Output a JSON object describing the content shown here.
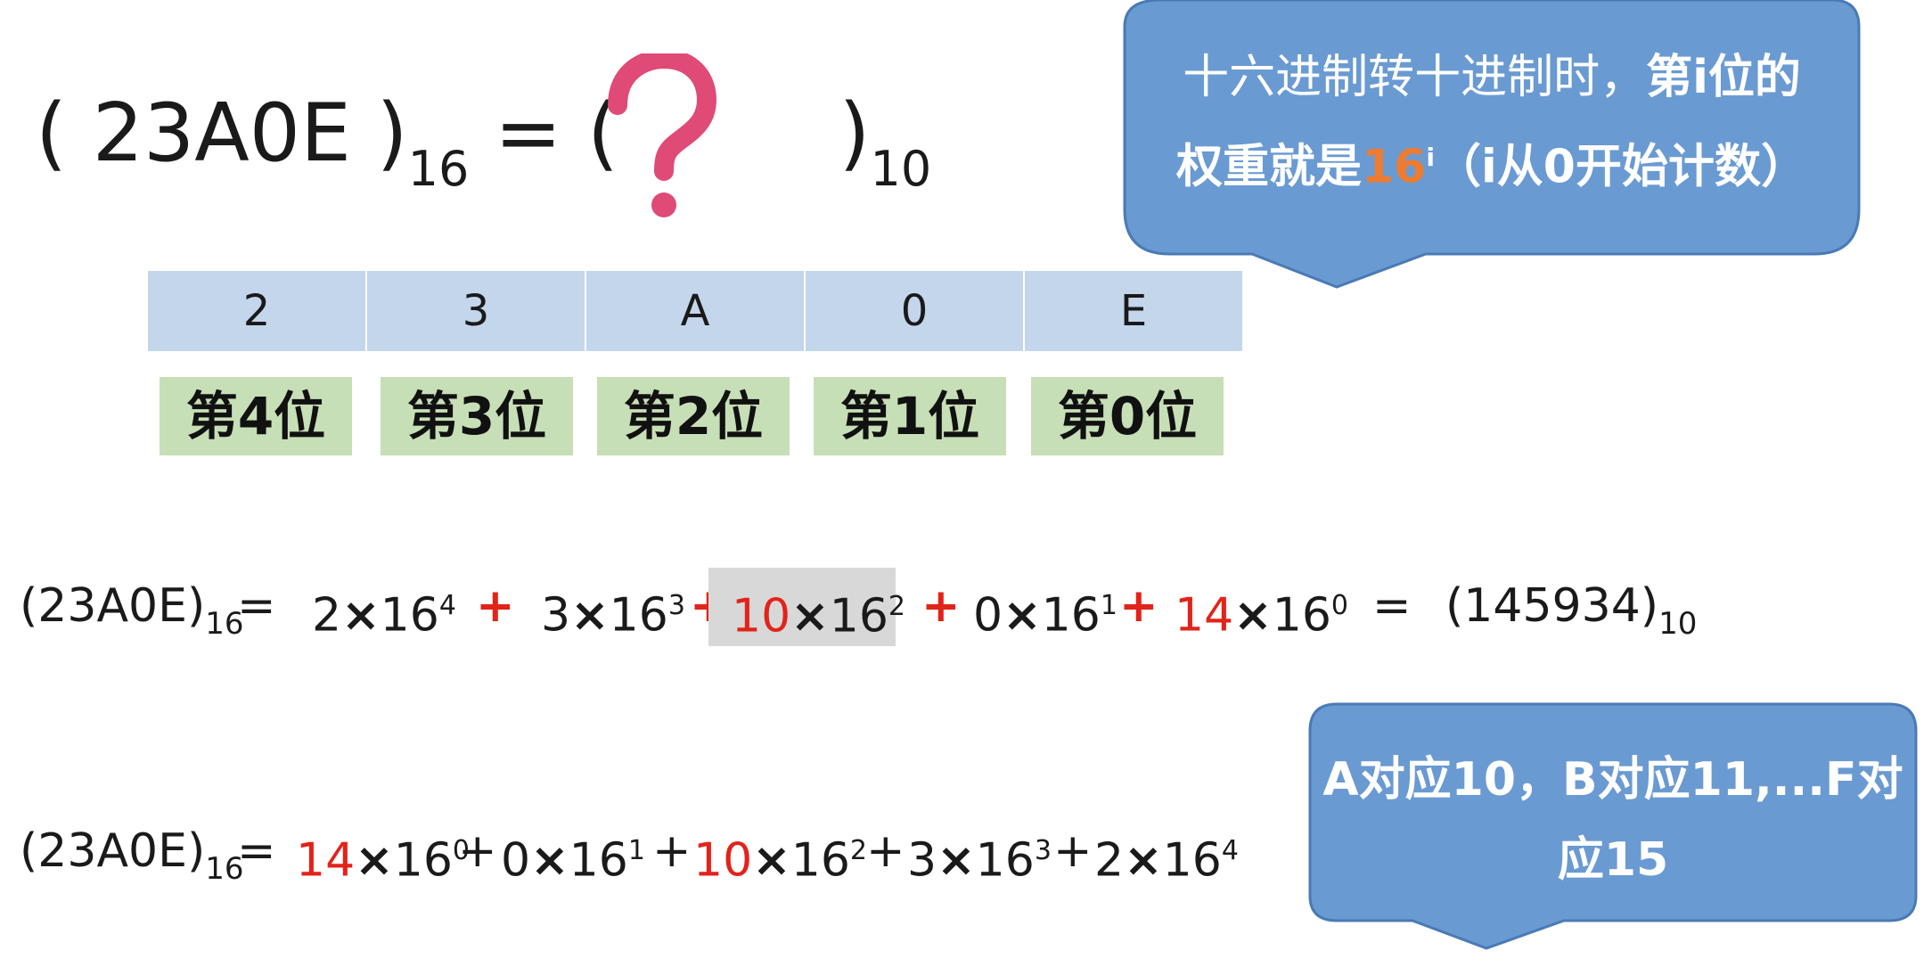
{
  "title": {
    "open": "( 23A0E )",
    "sub16": "16",
    "mid": "= (",
    "close": ")",
    "sub10": "10"
  },
  "digits": [
    "2",
    "3",
    "A",
    "0",
    "E"
  ],
  "positions": [
    "第4位",
    "第3位",
    "第2位",
    "第1位",
    "第0位"
  ],
  "callout1": {
    "line1_a": "十六进制转十进制时，",
    "line1_b": "第i位的",
    "line2_a": "权重就是",
    "line2_hl": "16",
    "line2_sup": "i",
    "line2_b": "（i从0开始计数）"
  },
  "callout2": {
    "line1": "A对应10，B对应11,...F对",
    "line2": "应15"
  },
  "eq1": {
    "lhs": "(23A0E)",
    "lhs_sub": "16",
    "eq": "=",
    "t1_coef": "2",
    "t1_base": "16",
    "t1_exp": "4",
    "plus1": "+",
    "t2_coef": "3",
    "t2_base": "16",
    "t2_exp": "3",
    "plus2": "+",
    "t3_coef": "10",
    "t3_base": "16",
    "t3_exp": "2",
    "plus3": "+",
    "t4_coef": "0",
    "t4_base": "16",
    "t4_exp": "1",
    "plus4": "+",
    "t5_coef": "14",
    "t5_base": "16",
    "t5_exp": "0",
    "eq2": "=",
    "result": "(145934)",
    "result_sub": "10"
  },
  "eq2": {
    "lhs": "(23A0E)",
    "lhs_sub": "16",
    "eq": "=",
    "t1_coef": "14",
    "t1_base": "16",
    "t1_exp": "0",
    "plus1": "+",
    "t2_coef": "0",
    "t2_base": "16",
    "t2_exp": "1",
    "plus2": "+",
    "t3_coef": "10",
    "t3_base": "16",
    "t3_exp": "2",
    "plus3": "+",
    "t4_coef": "3",
    "t4_base": "16",
    "t4_exp": "3",
    "plus4": "+",
    "t5_coef": "2",
    "t5_base": "16",
    "t5_exp": "4"
  },
  "colors": {
    "digit_bg": "#c3d6ec",
    "position_bg": "#c7dfb6",
    "callout_fill": "#6a9ad2",
    "callout_stroke": "#4a7ab6",
    "highlight_orange": "#ee7c30",
    "red": "#e2231a",
    "qmark": "#e04a77",
    "gray_box": "#d8d8d8"
  },
  "icons": {
    "question": "question-mark-icon"
  }
}
